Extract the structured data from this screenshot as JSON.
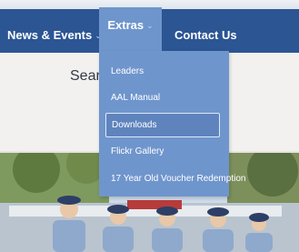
{
  "nav": {
    "items": [
      {
        "label": "News & Events",
        "chevron": "⌄"
      },
      {
        "label": "Extras",
        "chevron": "⌄"
      },
      {
        "label": "Contact Us"
      }
    ]
  },
  "dropdown": {
    "items": [
      {
        "label": "Leaders"
      },
      {
        "label": "AAL Manual"
      },
      {
        "label": "Downloads"
      },
      {
        "label": "Flickr Gallery"
      },
      {
        "label": "17 Year Old Voucher Redemption"
      }
    ],
    "active_index": 2
  },
  "search": {
    "label": "Sear"
  },
  "colors": {
    "nav_bg": "#2c5594",
    "dropdown_bg": "#6f95cd",
    "active_item_bg": "#5f84bd"
  }
}
